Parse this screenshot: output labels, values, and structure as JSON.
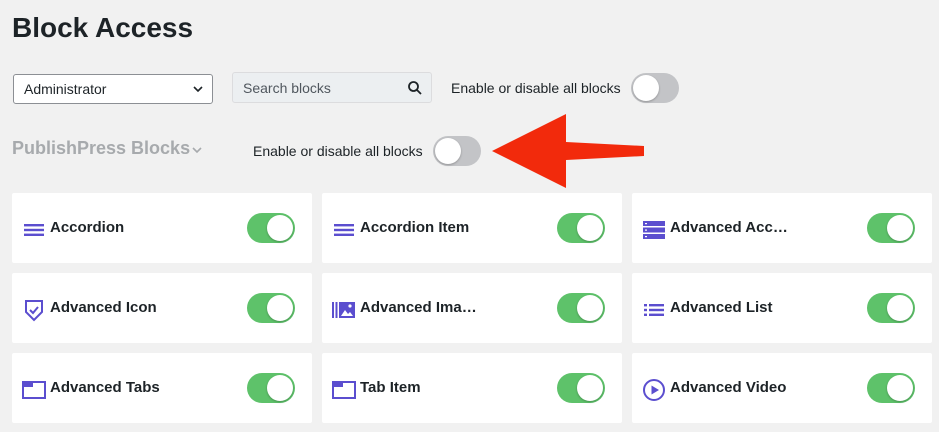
{
  "page": {
    "title": "Block Access"
  },
  "toolbar": {
    "role_value": "Administrator",
    "search_placeholder": "Search blocks",
    "toggle_all_label": "Enable or disable all blocks",
    "toggle_all_state": "off"
  },
  "section": {
    "title": "PublishPress Blocks",
    "toggle_label": "Enable or disable all blocks",
    "toggle_state": "off"
  },
  "colors": {
    "accent": "#5b4ecf",
    "toggle_on": "#5ec26a",
    "toggle_off": "#c3c4c7",
    "arrow": "#f22a0c"
  },
  "blocks": [
    {
      "label": "Accordion",
      "icon": "menu-lines-icon",
      "enabled": true
    },
    {
      "label": "Accordion Item",
      "icon": "menu-lines-icon",
      "enabled": true
    },
    {
      "label": "Advanced Acc…",
      "icon": "server-list-icon",
      "enabled": true
    },
    {
      "label": "Advanced Icon",
      "icon": "shield-check-icon",
      "enabled": true
    },
    {
      "label": "Advanced Ima…",
      "icon": "image-gallery-icon",
      "enabled": true
    },
    {
      "label": "Advanced List",
      "icon": "bullet-list-icon",
      "enabled": true
    },
    {
      "label": "Advanced Tabs",
      "icon": "tab-window-icon",
      "enabled": true
    },
    {
      "label": "Tab Item",
      "icon": "tab-window-icon",
      "enabled": true
    },
    {
      "label": "Advanced Video",
      "icon": "play-circle-icon",
      "enabled": true
    }
  ]
}
